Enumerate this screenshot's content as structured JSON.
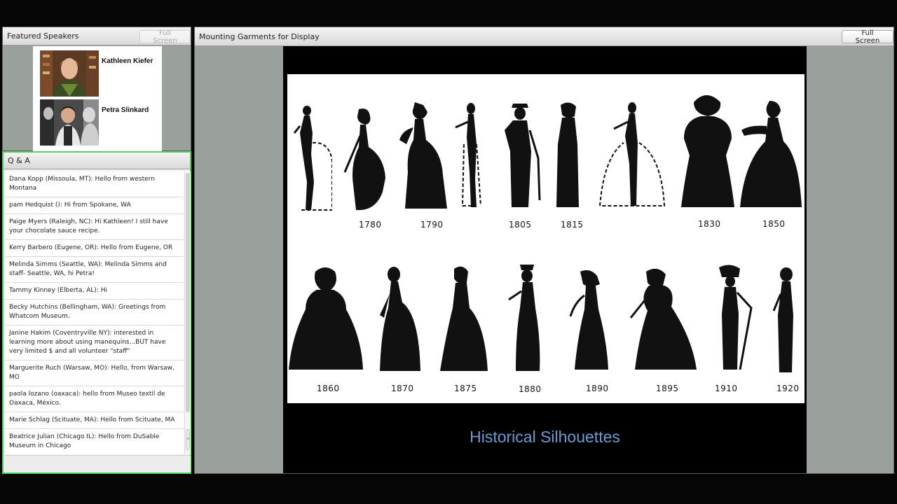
{
  "speakers_pod": {
    "title": "Featured Speakers",
    "fullscreen_label": "Full Screen",
    "speakers": [
      {
        "name": "Kathleen Kiefer"
      },
      {
        "name": "Petra Slinkard"
      }
    ]
  },
  "qa_pod": {
    "title": "Q & A",
    "messages": [
      {
        "text": "Dana Kopp (Missoula, MT): Hello from western Montana"
      },
      {
        "text": "pam Hedquist (): Hi from Spokane, WA"
      },
      {
        "text": "Paige Myers (Raleigh, NC): Hi Kathleen!  I still have your chocolate sauce recipe."
      },
      {
        "text": "Kerry Barbero (Eugene, OR): Hello from Eugene, OR"
      },
      {
        "text": "Melinda Simms (Seattle, WA): Melinda Simms and staff- Seattle, WA, hi Petra!"
      },
      {
        "text": "Tammy Kinney (Elberta, AL): Hi"
      },
      {
        "text": "Becky Hutchins (Bellingham, WA): Greetings from Whatcom Museum."
      },
      {
        "text": "Janine Hakim (Coventryville NY): interested in learning more about using manequins...BUT have very limited $ and all volunteer \"staff\""
      },
      {
        "text": "Marguerite Ruch (Warsaw, MO): Hello, from Warsaw, MO"
      },
      {
        "text": "paola  lozano  (oaxaca): hello from Museo textil de Oaxaca, México."
      },
      {
        "text": "Marie Schlag (Scituate, MA): Hello from Scituate, MA"
      },
      {
        "text": "Beatrice Julian (Chicago IL): Hello from DuSable Museum in Chicago"
      }
    ]
  },
  "share_pod": {
    "title": "Mounting Garments for Display",
    "fullscreen_label": "Full Screen",
    "slide": {
      "caption": "Historical Silhouettes",
      "top_row_years": [
        "1780",
        "1790",
        "1805",
        "1815",
        "1830",
        "1850"
      ],
      "bottom_row_years": [
        "1860",
        "1870",
        "1875",
        "1880",
        "1890",
        "1895",
        "1910",
        "1920"
      ]
    }
  },
  "colors": {
    "qa_border": "#4fd35a",
    "caption": "#6f9bd3",
    "pod_background": "#9aa09a"
  }
}
